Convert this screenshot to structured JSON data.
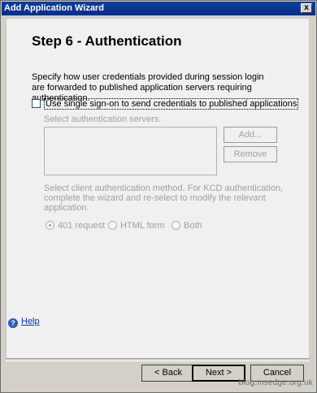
{
  "window": {
    "title": "Add Application Wizard",
    "close_glyph": "x"
  },
  "page": {
    "heading": "Step 6 - Authentication",
    "description": "Specify how user credentials provided during session login are forwarded to published application servers requiring authentication.",
    "sso_checkbox": {
      "label": "Use single sign-on to send credentials to published applications",
      "checked": false
    },
    "servers_label": "Select authentication servers:",
    "add_button": "Add...",
    "remove_button": "Remove",
    "method_text": "Select client authentication method. For KCD authentication, complete the wizard and re-select to modify the relevant application.",
    "radios": [
      {
        "label": "401 request",
        "checked": true
      },
      {
        "label": "HTML form",
        "checked": false
      },
      {
        "label": "Both",
        "checked": false
      }
    ]
  },
  "help": {
    "label": "Help",
    "icon": "help-icon"
  },
  "footer": {
    "back": "< Back",
    "next": "Next >",
    "cancel": "Cancel"
  },
  "watermark": "blog.msedge.org.uk"
}
